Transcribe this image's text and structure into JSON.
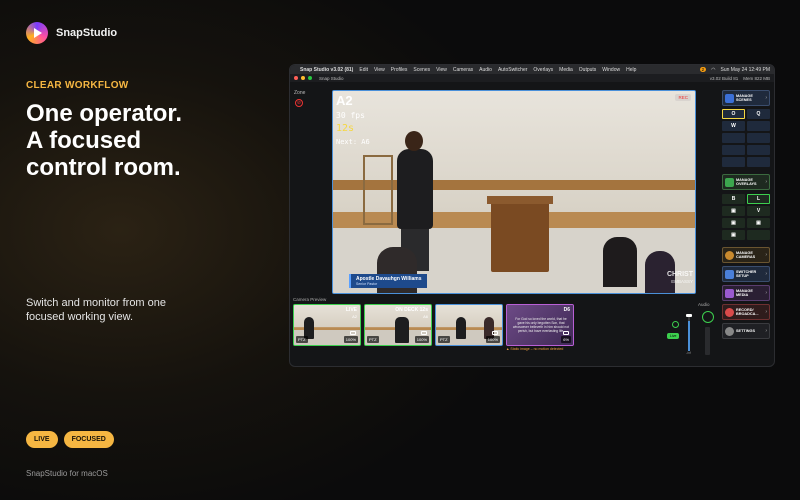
{
  "brand": {
    "name": "SnapStudio",
    "logo_icon": "snapstudio-logo-icon"
  },
  "hero": {
    "eyebrow": "CLEAR WORKFLOW",
    "headline_l1": "One operator.",
    "headline_l2": "A focused",
    "headline_l3": "control room.",
    "subtext": "Switch and monitor from one focused working view.",
    "pills": [
      "LIVE",
      "FOCUSED"
    ],
    "footer": "SnapStudio for macOS"
  },
  "colors": {
    "accent": "#f5b642",
    "live_green": "#3ccf4e",
    "program_blue": "#4a90d9"
  },
  "app": {
    "menubar": {
      "app_title": "Snap Studio v3.02 (81)",
      "items": [
        "Edit",
        "View",
        "Profiles",
        "Scenes",
        "View",
        "Cameras",
        "Audio",
        "AutoSwitcher",
        "Overlays",
        "Media",
        "Outputs",
        "Window",
        "Help"
      ],
      "badge": "2",
      "clock": "Sun May 24  12:49 PM"
    },
    "titlebar": {
      "title": "Snap Studio",
      "version": "v3.02  Build 81",
      "mem": "Mem 822 MB"
    },
    "zone_label": "Zone",
    "program": {
      "camera": "A2",
      "fps": "30 fps",
      "timer": "12s",
      "next": "Next: A6",
      "rec_badge": "REC",
      "lower_third_name": "Apostle Davauhgn Williams",
      "lower_third_title": "Senior Pastor",
      "watermark_title": "CHRIST",
      "watermark_sub": "EMBASSY"
    },
    "previews": {
      "label": "Camera Preview",
      "items": [
        {
          "tag": "LIVE",
          "sub": "A2",
          "ptz": "PTZ",
          "pct": "100%"
        },
        {
          "tag": "ON DECK 12s",
          "sub": "A6",
          "ptz": "PTZ",
          "pct": "100%"
        },
        {
          "tag": "",
          "sub": "",
          "ptz": "PTZ",
          "pct": "100%"
        },
        {
          "tag": "D6",
          "sub": "",
          "ptz": "",
          "pct": "6%"
        }
      ],
      "verse_text": "For God so loved the world, that he gave his only begotten Son, that whosoever believeth in him should not perish, but have everlasting life.",
      "scene_warning": "▲ Static image – no motion detected"
    },
    "audio": {
      "label": "Audio",
      "mute_chip": "Live",
      "db_label": "-inf"
    },
    "sidebar": {
      "manage_scenes": "MANAGE SCENES",
      "scene_keys": [
        "O",
        "Q",
        "W",
        "",
        "",
        "",
        "",
        "",
        "",
        ""
      ],
      "manage_overlays": "MANAGE OVERLAYS",
      "overlay_keys": [
        "B",
        "L",
        "",
        "V",
        "",
        "",
        "",
        ""
      ],
      "manage_cameras": "MANAGE CAMERAS",
      "switcher_setup": "SWITCHER SETUP",
      "manage_media": "MANAGE MEDIA",
      "record_broadcast": "RECORD/ BROADCA...",
      "settings": "SETTINGS"
    }
  }
}
